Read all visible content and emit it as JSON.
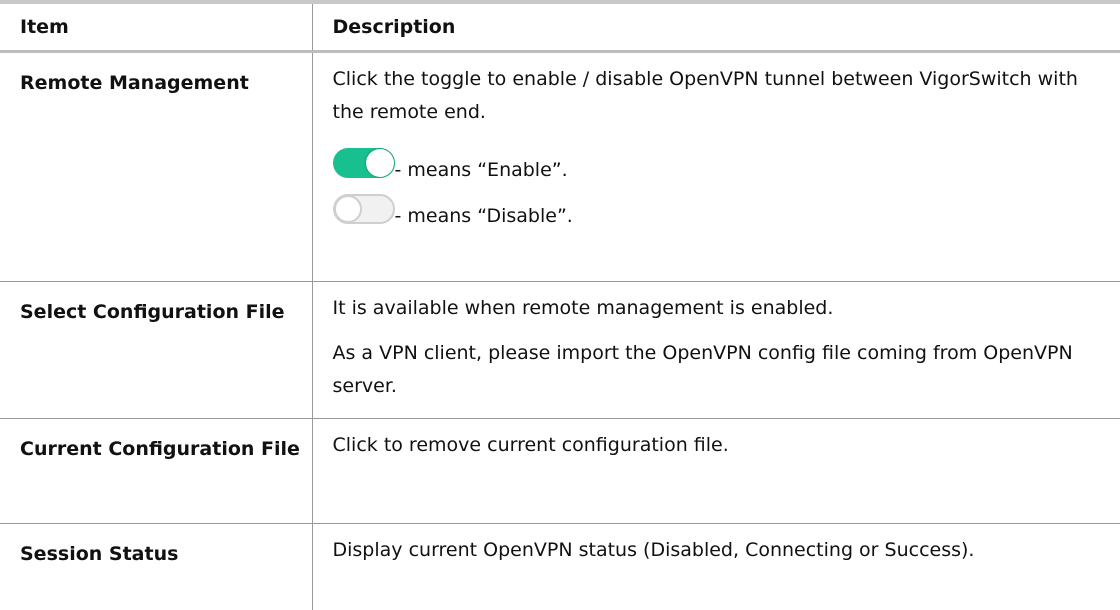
{
  "header": {
    "item": "Item",
    "description": "Description"
  },
  "rows": [
    {
      "item": "Remote Management",
      "desc": [
        "Click the toggle to enable / disable OpenVPN tunnel between VigorSwitch with the remote end.",
        "- means “Enable”.",
        "- means “Disable”."
      ],
      "toggles": [
        "on",
        "off"
      ]
    },
    {
      "item": "Select Configuration File",
      "desc": [
        "It is available when remote management is enabled.",
        "As a VPN client, please import the OpenVPN config file coming from OpenVPN server."
      ]
    },
    {
      "item": "Current Configuration File",
      "desc": [
        "Click to remove current configuration file."
      ]
    },
    {
      "item": "Session Status",
      "desc": [
        "Display current OpenVPN status (Disabled, Connecting or Success)."
      ]
    }
  ],
  "colors": {
    "toggle_on": "#18bf8f",
    "toggle_off_border": "#cfcfcf"
  }
}
